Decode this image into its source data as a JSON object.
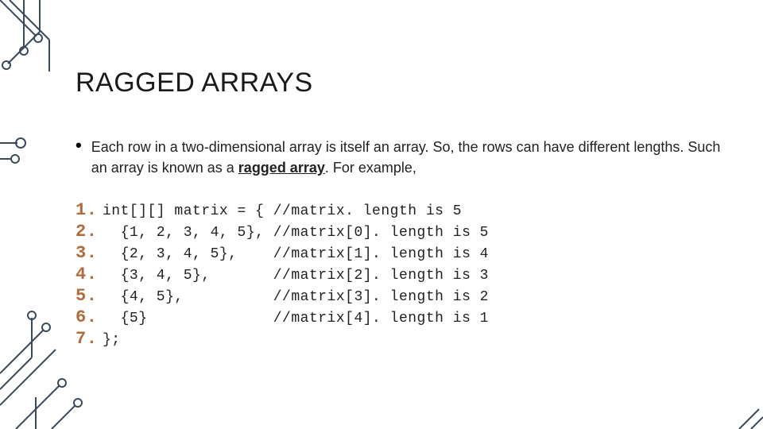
{
  "slide": {
    "title": "RAGGED ARRAYS",
    "bullet": {
      "text_prefix": "Each row in a two-dimensional array is itself an array. So, the rows can have different lengths. Such an array is known as a ",
      "bold_term": "ragged array",
      "text_suffix": ". For example,"
    },
    "code": [
      {
        "n": "1.",
        "text": "int[][] matrix = { //matrix. length is 5"
      },
      {
        "n": "2.",
        "text": "  {1, 2, 3, 4, 5}, //matrix[0]. length is 5"
      },
      {
        "n": "3.",
        "text": "  {2, 3, 4, 5},    //matrix[1]. length is 4"
      },
      {
        "n": "4.",
        "text": "  {3, 4, 5},       //matrix[2]. length is 3"
      },
      {
        "n": "5.",
        "text": "  {4, 5},          //matrix[3]. length is 2"
      },
      {
        "n": "6.",
        "text": "  {5}              //matrix[4]. length is 1"
      },
      {
        "n": "7.",
        "text": "};"
      }
    ]
  },
  "colors": {
    "line_number": "#b06a3b",
    "circuit_line": "#3b4a5a",
    "text": "#222222"
  }
}
